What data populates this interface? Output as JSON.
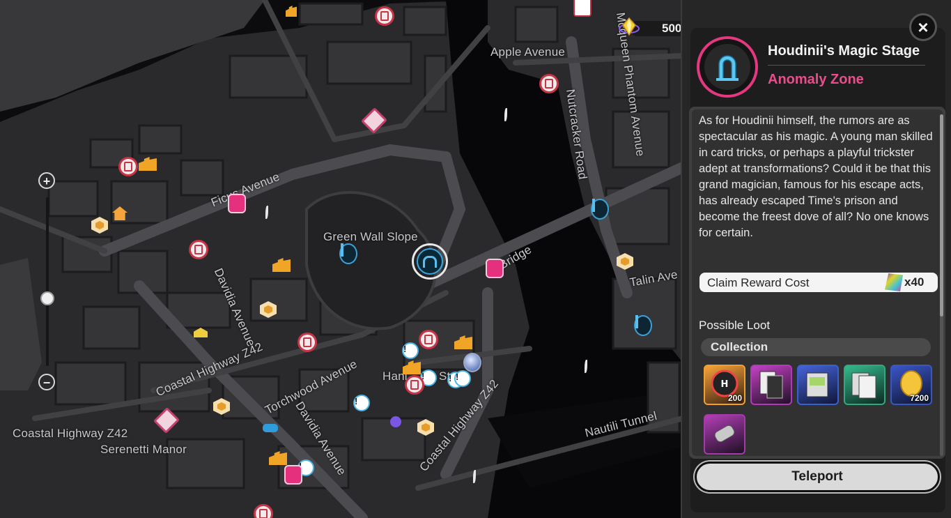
{
  "map": {
    "street_labels": [
      "Apple Avenue",
      "Mcqueen Phantom Avenue",
      "Nutcracker Road",
      "Ficus Avenue",
      "Green Wall Slope",
      "Davidia Avenue",
      "Bridge",
      "Talin Ave",
      "Coastal Highway Z42",
      "Torchwood Avenue",
      "Hani",
      "St",
      "Coastal Highway Z42",
      "Nautili Tunnel",
      "Coastal Highway Z42",
      "Serenetti Manor",
      "Davidia Avenue"
    ],
    "zoom_in_label": "+",
    "zoom_out_label": "−",
    "zoom_level": 0.6
  },
  "currency": {
    "icon": "polychrome-gem-icon",
    "value": "500"
  },
  "panel": {
    "close_label": "×",
    "title": "Houdinii's Magic Stage",
    "subtitle": "Anomaly Zone",
    "description": "As for Houdinii himself, the rumors are as spectacular as his magic. A young man skilled in card tricks, or perhaps a playful trickster adept at transformations? Could it be that this grand magician, famous for his escape acts, has already escaped Time's prison and become the freest dove of all? No one knows for certain.",
    "reward": {
      "label": "Claim Reward Cost",
      "quantity": "x40"
    },
    "loot_heading": "Possible Loot",
    "loot_tab": "Collection",
    "loot_items": [
      {
        "name": "hunter-badge-item",
        "quantity": "200"
      },
      {
        "name": "character-card-item",
        "quantity": ""
      },
      {
        "name": "music-disc-item",
        "quantity": ""
      },
      {
        "name": "document-set-item",
        "quantity": ""
      },
      {
        "name": "gold-egg-item",
        "quantity": "7200"
      },
      {
        "name": "key-item",
        "quantity": ""
      }
    ],
    "teleport_label": "Teleport",
    "accent_color": "#e4387f"
  }
}
